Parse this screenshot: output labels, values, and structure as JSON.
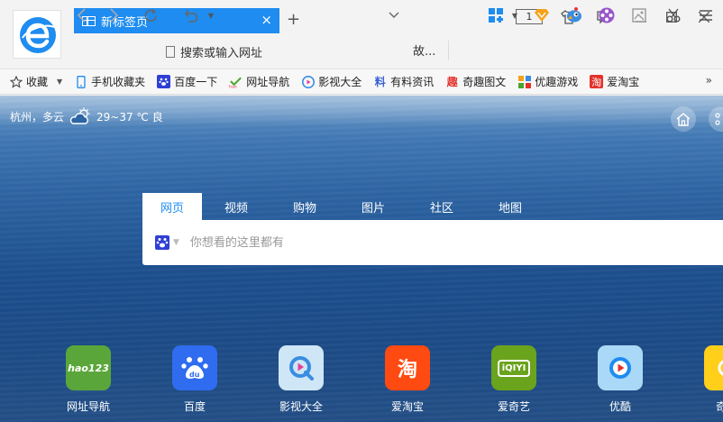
{
  "browser": {
    "tab_title": "新标签页",
    "tab_close": "×",
    "new_tab": "+",
    "window_count": "1",
    "address_placeholder": "搜索或输入网址",
    "search_engine_label": "故..."
  },
  "bookmarks": [
    {
      "label": "收藏",
      "icon": "star-icon"
    },
    {
      "label": "手机收藏夹",
      "icon": "phone-icon"
    },
    {
      "label": "百度一下",
      "icon": "baidu-paw-icon"
    },
    {
      "label": "网址导航",
      "icon": "hao-icon"
    },
    {
      "label": "影视大全",
      "icon": "video-icon"
    },
    {
      "label": "有料资讯",
      "icon": "news-icon"
    },
    {
      "label": "奇趣图文",
      "icon": "qu-icon"
    },
    {
      "label": "优趣游戏",
      "icon": "game-icon"
    },
    {
      "label": "爱淘宝",
      "icon": "taobao-icon"
    }
  ],
  "bookmarks_more": "»",
  "weather": {
    "city": "杭州，多云",
    "temp": "29~37 ℃ 良"
  },
  "search": {
    "tabs": [
      "网页",
      "视频",
      "购物",
      "图片",
      "社区",
      "地图"
    ],
    "active_tab": "网页",
    "placeholder": "你想看的这里都有"
  },
  "sites": [
    {
      "label": "网址导航",
      "tile_text": "hao123",
      "color": "#5aa63a"
    },
    {
      "label": "百度",
      "tile_text": "du",
      "color": "#2f6cf0"
    },
    {
      "label": "影视大全",
      "tile_text": "",
      "color": "#cfe6f6"
    },
    {
      "label": "爱淘宝",
      "tile_text": "淘",
      "color": "#ff4a12"
    },
    {
      "label": "爱奇艺",
      "tile_text": "iQIYI",
      "color": "#6aa31c"
    },
    {
      "label": "优酷",
      "tile_text": "",
      "color": "#aad8f7"
    },
    {
      "label": "奇趣",
      "tile_text": "",
      "color": "#ffcf1a"
    }
  ],
  "colors": {
    "accent": "#1e8cf0"
  }
}
